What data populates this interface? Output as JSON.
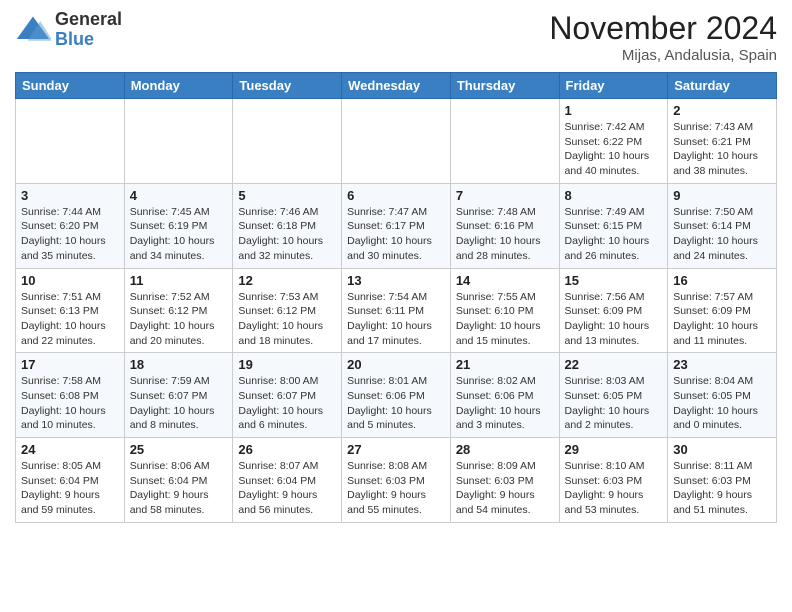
{
  "header": {
    "logo": {
      "general": "General",
      "blue": "Blue"
    },
    "title": "November 2024",
    "location": "Mijas, Andalusia, Spain"
  },
  "weekdays": [
    "Sunday",
    "Monday",
    "Tuesday",
    "Wednesday",
    "Thursday",
    "Friday",
    "Saturday"
  ],
  "weeks": [
    [
      {
        "day": "",
        "info": ""
      },
      {
        "day": "",
        "info": ""
      },
      {
        "day": "",
        "info": ""
      },
      {
        "day": "",
        "info": ""
      },
      {
        "day": "",
        "info": ""
      },
      {
        "day": "1",
        "info": "Sunrise: 7:42 AM\nSunset: 6:22 PM\nDaylight: 10 hours and 40 minutes."
      },
      {
        "day": "2",
        "info": "Sunrise: 7:43 AM\nSunset: 6:21 PM\nDaylight: 10 hours and 38 minutes."
      }
    ],
    [
      {
        "day": "3",
        "info": "Sunrise: 7:44 AM\nSunset: 6:20 PM\nDaylight: 10 hours and 35 minutes."
      },
      {
        "day": "4",
        "info": "Sunrise: 7:45 AM\nSunset: 6:19 PM\nDaylight: 10 hours and 34 minutes."
      },
      {
        "day": "5",
        "info": "Sunrise: 7:46 AM\nSunset: 6:18 PM\nDaylight: 10 hours and 32 minutes."
      },
      {
        "day": "6",
        "info": "Sunrise: 7:47 AM\nSunset: 6:17 PM\nDaylight: 10 hours and 30 minutes."
      },
      {
        "day": "7",
        "info": "Sunrise: 7:48 AM\nSunset: 6:16 PM\nDaylight: 10 hours and 28 minutes."
      },
      {
        "day": "8",
        "info": "Sunrise: 7:49 AM\nSunset: 6:15 PM\nDaylight: 10 hours and 26 minutes."
      },
      {
        "day": "9",
        "info": "Sunrise: 7:50 AM\nSunset: 6:14 PM\nDaylight: 10 hours and 24 minutes."
      }
    ],
    [
      {
        "day": "10",
        "info": "Sunrise: 7:51 AM\nSunset: 6:13 PM\nDaylight: 10 hours and 22 minutes."
      },
      {
        "day": "11",
        "info": "Sunrise: 7:52 AM\nSunset: 6:12 PM\nDaylight: 10 hours and 20 minutes."
      },
      {
        "day": "12",
        "info": "Sunrise: 7:53 AM\nSunset: 6:12 PM\nDaylight: 10 hours and 18 minutes."
      },
      {
        "day": "13",
        "info": "Sunrise: 7:54 AM\nSunset: 6:11 PM\nDaylight: 10 hours and 17 minutes."
      },
      {
        "day": "14",
        "info": "Sunrise: 7:55 AM\nSunset: 6:10 PM\nDaylight: 10 hours and 15 minutes."
      },
      {
        "day": "15",
        "info": "Sunrise: 7:56 AM\nSunset: 6:09 PM\nDaylight: 10 hours and 13 minutes."
      },
      {
        "day": "16",
        "info": "Sunrise: 7:57 AM\nSunset: 6:09 PM\nDaylight: 10 hours and 11 minutes."
      }
    ],
    [
      {
        "day": "17",
        "info": "Sunrise: 7:58 AM\nSunset: 6:08 PM\nDaylight: 10 hours and 10 minutes."
      },
      {
        "day": "18",
        "info": "Sunrise: 7:59 AM\nSunset: 6:07 PM\nDaylight: 10 hours and 8 minutes."
      },
      {
        "day": "19",
        "info": "Sunrise: 8:00 AM\nSunset: 6:07 PM\nDaylight: 10 hours and 6 minutes."
      },
      {
        "day": "20",
        "info": "Sunrise: 8:01 AM\nSunset: 6:06 PM\nDaylight: 10 hours and 5 minutes."
      },
      {
        "day": "21",
        "info": "Sunrise: 8:02 AM\nSunset: 6:06 PM\nDaylight: 10 hours and 3 minutes."
      },
      {
        "day": "22",
        "info": "Sunrise: 8:03 AM\nSunset: 6:05 PM\nDaylight: 10 hours and 2 minutes."
      },
      {
        "day": "23",
        "info": "Sunrise: 8:04 AM\nSunset: 6:05 PM\nDaylight: 10 hours and 0 minutes."
      }
    ],
    [
      {
        "day": "24",
        "info": "Sunrise: 8:05 AM\nSunset: 6:04 PM\nDaylight: 9 hours and 59 minutes."
      },
      {
        "day": "25",
        "info": "Sunrise: 8:06 AM\nSunset: 6:04 PM\nDaylight: 9 hours and 58 minutes."
      },
      {
        "day": "26",
        "info": "Sunrise: 8:07 AM\nSunset: 6:04 PM\nDaylight: 9 hours and 56 minutes."
      },
      {
        "day": "27",
        "info": "Sunrise: 8:08 AM\nSunset: 6:03 PM\nDaylight: 9 hours and 55 minutes."
      },
      {
        "day": "28",
        "info": "Sunrise: 8:09 AM\nSunset: 6:03 PM\nDaylight: 9 hours and 54 minutes."
      },
      {
        "day": "29",
        "info": "Sunrise: 8:10 AM\nSunset: 6:03 PM\nDaylight: 9 hours and 53 minutes."
      },
      {
        "day": "30",
        "info": "Sunrise: 8:11 AM\nSunset: 6:03 PM\nDaylight: 9 hours and 51 minutes."
      }
    ]
  ]
}
